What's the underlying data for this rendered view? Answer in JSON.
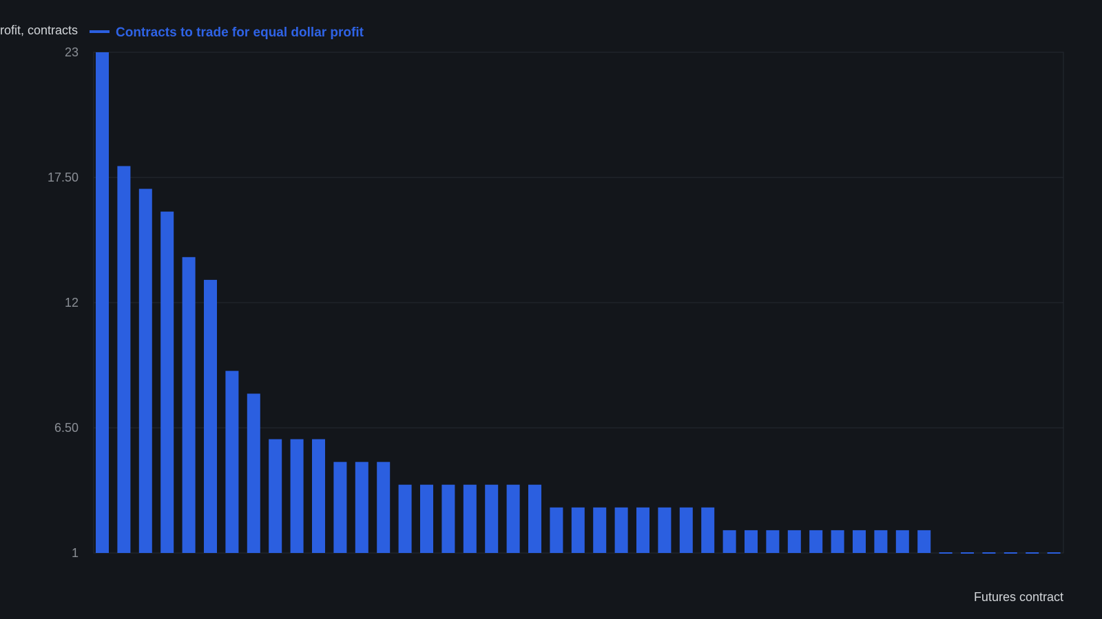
{
  "chart_data": {
    "type": "bar",
    "ylabel": "Contracts to trade for equal dollar profit, contracts",
    "xlabel": "Futures contract",
    "ylim": [
      1,
      23
    ],
    "yticks": [
      "1",
      "6.50",
      "12",
      "17.50",
      "23"
    ],
    "grid": true,
    "legend_position": "top-left",
    "colors": {
      "bar": "#2b5fe0",
      "background": "#13161b",
      "grid": "#262a31"
    },
    "series": [
      {
        "name": "Contracts to trade for equal dollar profit",
        "values": [
          23,
          18,
          17,
          16,
          14,
          13,
          9,
          8,
          6,
          6,
          6,
          5,
          5,
          5,
          4,
          4,
          4,
          4,
          4,
          4,
          4,
          3,
          3,
          3,
          3,
          3,
          3,
          3,
          3,
          2,
          2,
          2,
          2,
          2,
          2,
          2,
          2,
          2,
          2,
          1,
          1,
          1,
          1,
          1,
          1
        ]
      }
    ]
  }
}
